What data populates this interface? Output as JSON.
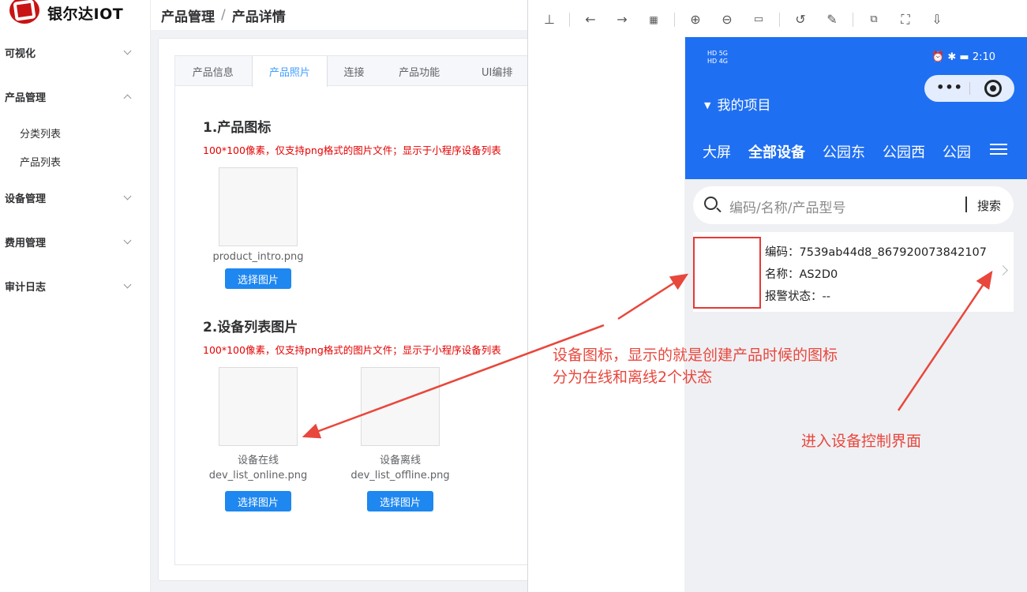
{
  "app": {
    "logo_text": "银尔达IOT"
  },
  "breadcrumb": {
    "parent": "产品管理",
    "separator": "/",
    "current": "产品详情"
  },
  "sidebar": {
    "items": [
      {
        "label": "可视化",
        "expanded": false
      },
      {
        "label": "产品管理",
        "expanded": true,
        "children": [
          "分类列表",
          "产品列表"
        ]
      },
      {
        "label": "设备管理",
        "expanded": false
      },
      {
        "label": "费用管理",
        "expanded": false
      },
      {
        "label": "审计日志",
        "expanded": false
      }
    ]
  },
  "tabs": [
    "产品信息",
    "产品照片",
    "连接",
    "产品功能",
    "UI编排"
  ],
  "active_tab": "产品照片",
  "section1": {
    "title": "1.产品图标",
    "note": "100*100像素，仅支持png格式的图片文件；显示于小程序设备列表",
    "image": {
      "caption": "product_intro.png",
      "button": "选择图片"
    }
  },
  "section2": {
    "title": "2.设备列表图片",
    "note": "100*100像素，仅支持png格式的图片文件；显示于小程序设备列表",
    "images": [
      {
        "label": "设备在线",
        "caption": "dev_list_online.png",
        "button": "选择图片"
      },
      {
        "label": "设备离线",
        "caption": "dev_list_offline.png",
        "button": "选择图片"
      }
    ]
  },
  "viewer": {
    "toolbar_icons": [
      "pin-icon",
      "back-arrow-icon",
      "forward-arrow-icon",
      "grid-icon",
      "zoom-in-icon",
      "zoom-out-icon",
      "actual-size-icon",
      "rotate-icon",
      "edit-icon",
      "translate-icon",
      "crop-icon",
      "download-icon"
    ]
  },
  "phone": {
    "status_left_top": "HD 5G",
    "status_left_bottom": "HD 4G",
    "time": "2:10",
    "project_title": "我的项目",
    "tabs": [
      "大屏",
      "全部设备",
      "公园东",
      "公园西",
      "公园"
    ],
    "active_tab": "全部设备",
    "search_placeholder": "编码/名称/产品型号",
    "search_button": "搜索",
    "device": {
      "code_label": "编码：",
      "code": "7539ab44d8_867920073842107",
      "name_label": "名称：",
      "name": "AS2D0",
      "alarm_label": "报警状态：",
      "alarm": "--"
    }
  },
  "annotations": {
    "icon_note_line1": "设备图标，显示的就是创建产品时候的图标",
    "icon_note_line2": "分为在线和离线2个状态",
    "control_note": "进入设备控制界面",
    "color": "#e8473c"
  },
  "colors": {
    "accent_blue": "#409eff",
    "button_blue": "#1e87f0",
    "note_red": "#e60000",
    "phone_header": "#1f6ff2"
  }
}
